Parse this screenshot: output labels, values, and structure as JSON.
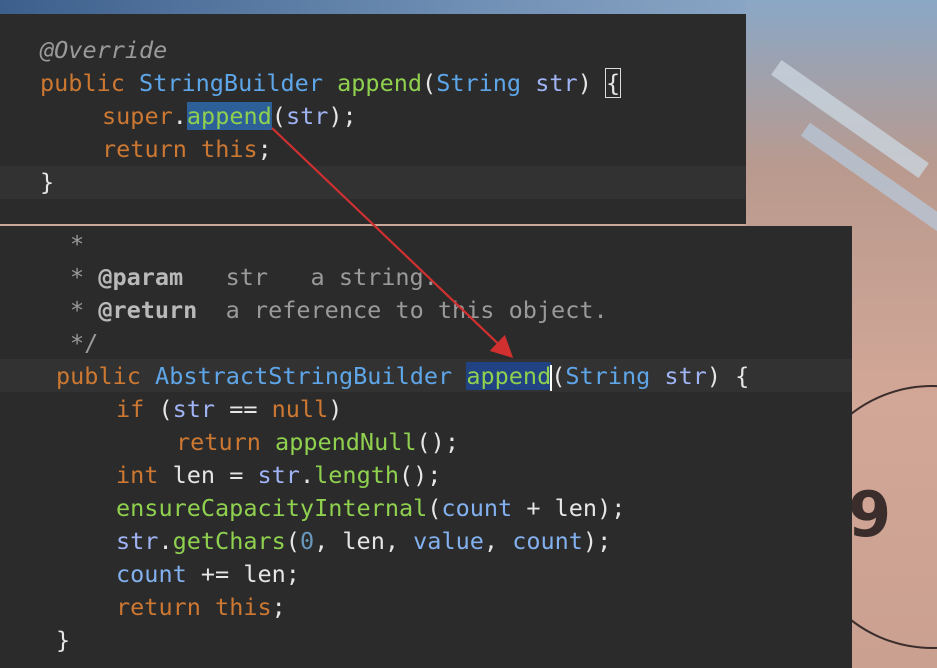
{
  "colors": {
    "editor_bg": "#2b2b2b",
    "keyword": "#cc7832",
    "type": "#5ea6e8",
    "method": "#8fd14f",
    "arrow": "#d03030"
  },
  "top_snippet": {
    "annotation": "@Override",
    "kw_public": "public",
    "return_type": "StringBuilder",
    "method_name": "append",
    "open_paren": "(",
    "param_type": "String",
    "param_name": "str",
    "close_sig": ") ",
    "open_brace": "{",
    "kw_super": "super",
    "dot": ".",
    "call_name": "append",
    "call_open": "(",
    "call_arg": "str",
    "call_close": ");",
    "kw_return": "return",
    "kw_this": "this",
    "semicolon": ";",
    "close_brace": "}"
  },
  "bottom_snippet": {
    "doc_star": "*",
    "doc_param_prefix": "* ",
    "doc_param_tag": "@param",
    "doc_param_text": "   str   a string.",
    "doc_return_prefix": "* ",
    "doc_return_tag": "@return",
    "doc_return_text": "  a reference to this object.",
    "doc_end": "*/",
    "kw_public": "public",
    "return_type": "AbstractStringBuilder",
    "method_name": "append",
    "open_paren": "(",
    "param_type": "String",
    "param_name": "str",
    "close_sig": ") {",
    "kw_if": "if",
    "if_open": " (",
    "if_var": "str",
    "if_op": " == ",
    "kw_null": "null",
    "if_close": ")",
    "kw_return1": "return",
    "call_appendNull": "appendNull",
    "call_appendNull_tail": "();",
    "kw_int": "int",
    "len_var": "len",
    "assign": " = ",
    "str_ref": "str",
    "dot1": ".",
    "length_call": "length",
    "length_tail": "();",
    "ensure_call": "ensureCapacityInternal",
    "ensure_open": "(",
    "ensure_count": "count",
    "ensure_plus": " + ",
    "ensure_len": "len",
    "ensure_close": ");",
    "str_ref2": "str",
    "dot2": ".",
    "getchars_call": "getChars",
    "getchars_open": "(",
    "getchars_zero": "0",
    "comma1": ", ",
    "getchars_len": "len",
    "comma2": ", ",
    "getchars_value": "value",
    "comma3": ", ",
    "getchars_count": "count",
    "getchars_close": ");",
    "count_var": "count",
    "plus_assign": " += ",
    "count_len": "len",
    "semi": ";",
    "kw_return2": "return",
    "kw_this": "this",
    "semi2": ";",
    "close_brace": "}"
  }
}
